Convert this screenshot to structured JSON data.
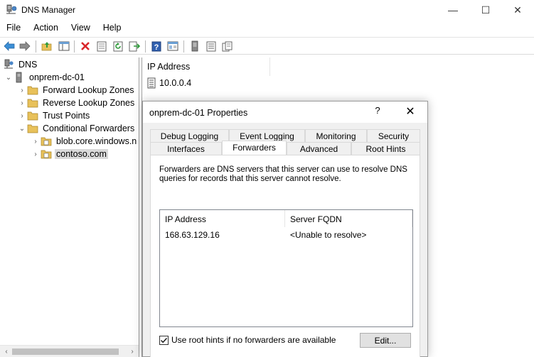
{
  "window": {
    "title": "DNS Manager",
    "controls": {
      "minimize": "—",
      "maximize": "☐",
      "close": "✕"
    }
  },
  "menu": [
    "File",
    "Action",
    "View",
    "Help"
  ],
  "toolbar": {
    "icons": [
      "back-icon",
      "forward-icon",
      "up-folder-icon",
      "show-hide-tree-icon",
      "delete-icon",
      "properties-icon",
      "refresh-icon",
      "export-list-icon",
      "help-icon",
      "mmc-icon",
      "server-icon",
      "list-icon",
      "copy-icon"
    ]
  },
  "tree": {
    "root": "DNS",
    "server": "onprem-dc-01",
    "children": [
      "Forward Lookup Zones",
      "Reverse Lookup Zones",
      "Trust Points",
      "Conditional Forwarders"
    ],
    "forwarders": [
      "blob.core.windows.n",
      "contoso.com"
    ],
    "selected": "contoso.com"
  },
  "list": {
    "column": "IP Address",
    "rows": [
      "10.0.0.4"
    ]
  },
  "dialog": {
    "title": "onprem-dc-01 Properties",
    "help": "?",
    "close": "✕",
    "tabs_back": [
      "Debug Logging",
      "Event Logging",
      "Monitoring",
      "Security"
    ],
    "tabs_front": [
      "Interfaces",
      "Forwarders",
      "Advanced",
      "Root Hints"
    ],
    "active_tab": "Forwarders",
    "description": "Forwarders are DNS servers that this server can use to resolve DNS queries for records that this server cannot resolve.",
    "columns": [
      "IP Address",
      "Server FQDN"
    ],
    "forwarders": [
      {
        "ip": "168.63.129.16",
        "fqdn": "<Unable to resolve>"
      }
    ],
    "use_root_hints_label": "Use root hints if no forwarders are available",
    "use_root_hints_checked": true,
    "edit_button": "Edit..."
  },
  "colors": {
    "folder": "#e8c15a",
    "selection": "#d9d9d9",
    "dialog_bg": "#f0f0f0"
  }
}
